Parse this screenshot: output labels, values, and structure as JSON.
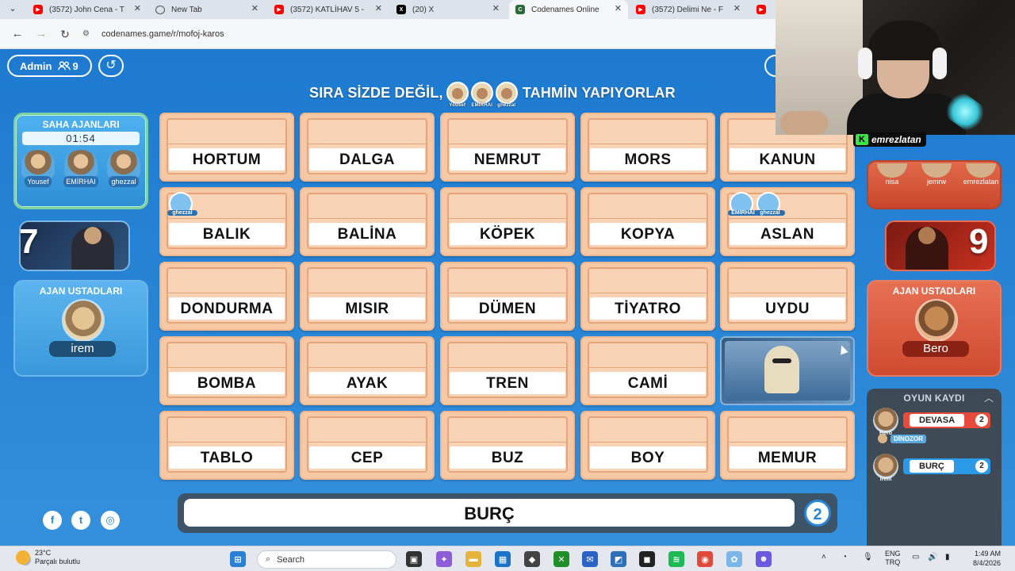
{
  "browser": {
    "tabs": [
      {
        "title": "(3572) John Cena - T",
        "icon": "youtube-icon"
      },
      {
        "title": "New Tab",
        "icon": "globe-icon"
      },
      {
        "title": "(3572) KATLİHAV 5 -",
        "icon": "youtube-icon"
      },
      {
        "title": "(20) X",
        "icon": "x-icon"
      },
      {
        "title": "Codenames Online",
        "icon": "codenames-icon"
      },
      {
        "title": "(3572) Delimi Ne - F",
        "icon": "youtube-icon"
      }
    ],
    "url": "codenames.game/r/mofoj-karos"
  },
  "game": {
    "admin_label": "Admin",
    "player_count": "9",
    "status_left": "SIRA SİZDE DEĞİL,",
    "status_right": "TAHMİN YAPIYORLAR",
    "status_avatars": [
      "Yousef",
      "EMİRHAI",
      "ghezzal"
    ],
    "blue_team": {
      "field_title": "SAHA AJANLARI",
      "timer": "01:54",
      "agents": [
        "Yousef",
        "EMİRHAI",
        "ghezzal"
      ],
      "score": "7",
      "master_title": "AJAN USTADLARI",
      "master": "irem"
    },
    "red_team": {
      "agents": [
        "nisa",
        "jemrw",
        "emrezlatan"
      ],
      "score": "9",
      "master_title": "AJAN USTADLARI",
      "master": "Bero"
    },
    "board": [
      {
        "word": "HORTUM"
      },
      {
        "word": "DALGA"
      },
      {
        "word": "NEMRUT"
      },
      {
        "word": "MORS"
      },
      {
        "word": "KANUN"
      },
      {
        "word": "BALIK",
        "picks": [
          "ghezzal"
        ]
      },
      {
        "word": "BALİNA"
      },
      {
        "word": "KÖPEK"
      },
      {
        "word": "KOPYA"
      },
      {
        "word": "ASLAN",
        "picks": [
          "EMİRHAI",
          "ghezzal"
        ]
      },
      {
        "word": "DONDURMA"
      },
      {
        "word": "MISIR"
      },
      {
        "word": "DÜMEN"
      },
      {
        "word": "TİYATRO"
      },
      {
        "word": "UYDU"
      },
      {
        "word": "BOMBA"
      },
      {
        "word": "AYAK"
      },
      {
        "word": "TREN"
      },
      {
        "word": "CAMİ"
      },
      {
        "word": "",
        "revealed": "blue-agent"
      },
      {
        "word": "TABLO"
      },
      {
        "word": "CEP"
      },
      {
        "word": "BUZ"
      },
      {
        "word": "BOY"
      },
      {
        "word": "MEMUR"
      }
    ],
    "clue": {
      "word": "BURÇ",
      "number": "2"
    },
    "log": {
      "title": "OYUN KAYDI",
      "entries": [
        {
          "player": "Bero",
          "clue": "DEVASA",
          "number": "2",
          "team": "red"
        },
        {
          "guess": "DİNOZOR"
        },
        {
          "player": "irem",
          "clue": "BURÇ",
          "number": "2",
          "team": "blue"
        }
      ]
    },
    "social": [
      "facebook-icon",
      "twitter-icon",
      "instagram-icon"
    ]
  },
  "stream": {
    "name": "emrezlatan"
  },
  "taskbar": {
    "temp": "23°C",
    "weather": "Parçalı bulutlu",
    "search": "Search",
    "lang1": "ENG",
    "lang2": "TRQ",
    "time": "1:49 AM",
    "date": "8/4/2026"
  }
}
